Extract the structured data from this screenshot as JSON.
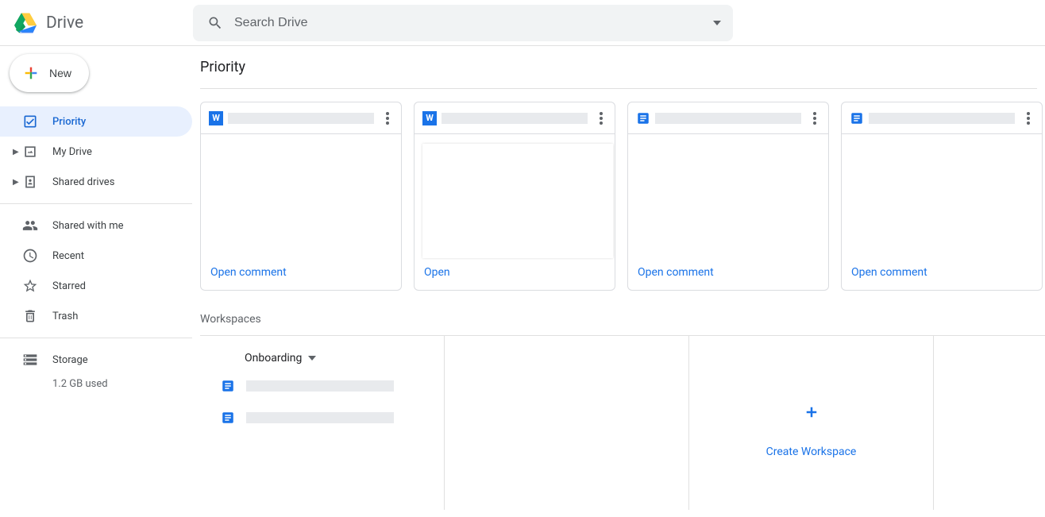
{
  "brand": {
    "name": "Drive"
  },
  "search": {
    "placeholder": "Search Drive"
  },
  "sidebar": {
    "new_label": "New",
    "items": [
      {
        "label": "Priority"
      },
      {
        "label": "My Drive"
      },
      {
        "label": "Shared drives"
      },
      {
        "label": "Shared with me"
      },
      {
        "label": "Recent"
      },
      {
        "label": "Starred"
      },
      {
        "label": "Trash"
      },
      {
        "label": "Storage"
      }
    ],
    "storage_used": "1.2 GB used"
  },
  "page": {
    "title": "Priority",
    "workspaces_label": "Workspaces"
  },
  "priority_cards": [
    {
      "type": "word",
      "action": "Open comment"
    },
    {
      "type": "word",
      "action": "Open",
      "show_inner": true
    },
    {
      "type": "docs",
      "action": "Open comment"
    },
    {
      "type": "docs",
      "action": "Open comment"
    }
  ],
  "workspaces": [
    {
      "name": "Onboarding",
      "files": [
        {
          "type": "docs"
        },
        {
          "type": "docs"
        }
      ]
    }
  ],
  "create_workspace_label": "Create Workspace"
}
